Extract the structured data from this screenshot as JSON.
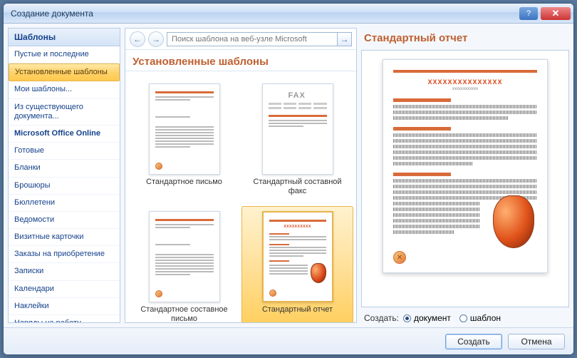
{
  "window": {
    "title": "Создание документа"
  },
  "sidebar": {
    "header": "Шаблоны",
    "items": [
      {
        "label": "Пустые и последние",
        "selected": false,
        "bold": false
      },
      {
        "label": "Установленные шаблоны",
        "selected": true,
        "bold": false
      },
      {
        "label": "Мои шаблоны...",
        "selected": false,
        "bold": false
      },
      {
        "label": "Из существующего документа...",
        "selected": false,
        "bold": false
      },
      {
        "label": "Microsoft Office Online",
        "selected": false,
        "bold": true
      },
      {
        "label": "Готовые",
        "selected": false,
        "bold": false
      },
      {
        "label": "Бланки",
        "selected": false,
        "bold": false
      },
      {
        "label": "Брошюры",
        "selected": false,
        "bold": false
      },
      {
        "label": "Бюллетени",
        "selected": false,
        "bold": false
      },
      {
        "label": "Ведомости",
        "selected": false,
        "bold": false
      },
      {
        "label": "Визитные карточки",
        "selected": false,
        "bold": false
      },
      {
        "label": "Заказы на приобретение",
        "selected": false,
        "bold": false
      },
      {
        "label": "Записки",
        "selected": false,
        "bold": false
      },
      {
        "label": "Календари",
        "selected": false,
        "bold": false
      },
      {
        "label": "Наклейки",
        "selected": false,
        "bold": false
      },
      {
        "label": "Наряды на работу",
        "selected": false,
        "bold": false
      }
    ]
  },
  "search": {
    "placeholder": "Поиск шаблона на веб-узле Microsoft"
  },
  "middle": {
    "title": "Установленные шаблоны",
    "items": [
      {
        "label": "Стандартное письмо",
        "kind": "letter",
        "selected": false
      },
      {
        "label": "Стандартный составной факс",
        "kind": "fax",
        "selected": false
      },
      {
        "label": "Стандартное составное письмо",
        "kind": "letter",
        "selected": false
      },
      {
        "label": "Стандартный отчет",
        "kind": "report",
        "selected": true
      }
    ]
  },
  "preview": {
    "title": "Стандартный отчет",
    "redtext": "XXXXXXXXXXXXXXX",
    "subtext": "xxxxxxxxxxxx"
  },
  "radiogroup": {
    "label": "Создать:",
    "options": [
      {
        "label": "документ",
        "checked": true
      },
      {
        "label": "шаблон",
        "checked": false
      }
    ]
  },
  "buttons": {
    "create": "Создать",
    "cancel": "Отмена"
  },
  "fax_label": "FAX"
}
